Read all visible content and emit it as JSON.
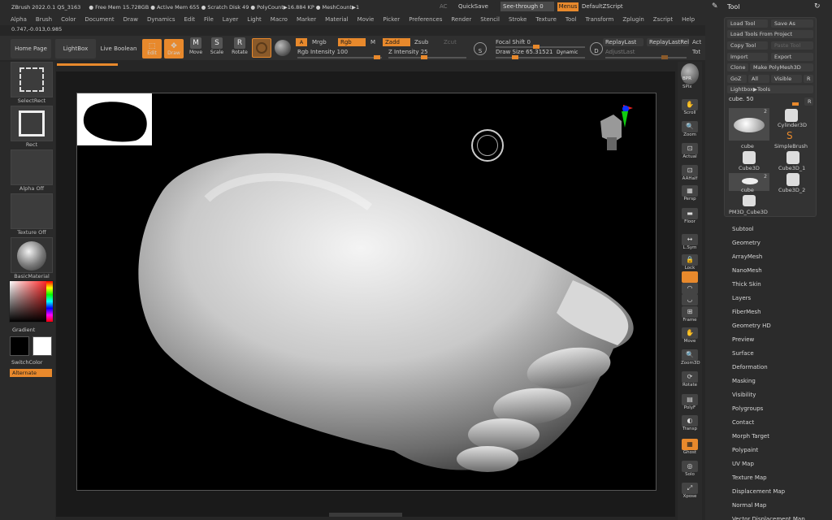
{
  "titlebar": {
    "app": "ZBrush 2022.0.1 QS_3163",
    "status": "● Free Mem 15.728GB ● Active Mem 655 ● Scratch Disk 49 ● PolyCount▶16.884 KP ● MeshCount▶1",
    "ac": "AC",
    "quicksave": "QuickSave",
    "seethrough": "See-through 0",
    "menus": "Menus",
    "script": "DefaultZScript"
  },
  "menubar": [
    "Alpha",
    "Brush",
    "Color",
    "Document",
    "Draw",
    "Dynamics",
    "Edit",
    "File",
    "Layer",
    "Light",
    "Macro",
    "Marker",
    "Material",
    "Movie",
    "Picker",
    "Preferences",
    "Render",
    "Stencil",
    "Stroke",
    "Texture",
    "Tool",
    "Transform",
    "Zplugin",
    "Zscript",
    "Help"
  ],
  "coords": "0.747,-0.013,0.985",
  "toolbar": {
    "home": "Home Page",
    "lightbox": "LightBox",
    "liveboolean": "Live Boolean",
    "edit": "Edit",
    "draw": "Draw",
    "move": "Move",
    "scale": "Scale",
    "rotate": "Rotate",
    "a": "A",
    "mrgb": "Mrgb",
    "rgb": "Rgb",
    "m": "M",
    "zadd": "Zadd",
    "zsub": "Zsub",
    "zcut": "Zcut",
    "rgb_intensity": "Rgb Intensity 100",
    "z_intensity": "Z Intensity 25",
    "focal_shift": "Focal Shift 0",
    "draw_size": "Draw Size 65.31521",
    "dynamic": "Dynamic",
    "replaylast": "ReplayLast",
    "replaylastrel": "ReplayLastRel",
    "act": "Act",
    "adjustlast": "AdjustLast",
    "tot": "Tot",
    "s": "S",
    "d": "D"
  },
  "left": {
    "selectrect": "SelectRect",
    "rect": "Rect",
    "alpha": "Alpha Off",
    "texture": "Texture Off",
    "material": "BasicMaterial",
    "gradient": "Gradient",
    "switchcolor": "SwitchColor",
    "alternate": "Alternate"
  },
  "rightstrip": [
    "BPR",
    "SPix",
    "Scroll",
    "Zoom",
    "Actual",
    "AAHalf",
    "Persp",
    "Floor",
    "L.Sym",
    "Lock",
    "XYZ",
    "",
    "",
    "Frame",
    "Move",
    "Zoom3D",
    "Rotate",
    "PolyF",
    "Transp",
    "Ghost",
    "Solo",
    "Xpose"
  ],
  "tool": {
    "title": "Tool",
    "load": "Load Tool",
    "saveas": "Save As",
    "loadproject": "Load Tools From Project",
    "copy": "Copy Tool",
    "paste": "Paste Tool",
    "import": "Import",
    "export": "Export",
    "clone": "Clone",
    "makepoly": "Make PolyMesh3D",
    "goz": "GoZ",
    "all": "All",
    "visible": "Visible",
    "r": "R",
    "lightboxtools": "Lightbox▶Tools",
    "current": "cube. 50",
    "thumbs": [
      {
        "label": "cube",
        "count": "2"
      },
      {
        "label": "Cylinder3D",
        "count": ""
      },
      {
        "label": "SimpleBrush",
        "count": ""
      },
      {
        "label": "Cube3D",
        "count": ""
      },
      {
        "label": "Cube3D_1",
        "count": ""
      },
      {
        "label": "cube",
        "count": "2"
      },
      {
        "label": "Cube3D_2",
        "count": ""
      },
      {
        "label": "PM3D_Cube3D",
        "count": ""
      }
    ]
  },
  "subpalettes": [
    "Subtool",
    "Geometry",
    "ArrayMesh",
    "NanoMesh",
    "Thick Skin",
    "Layers",
    "FiberMesh",
    "Geometry HD",
    "Preview",
    "Surface",
    "Deformation",
    "Masking",
    "Visibility",
    "Polygroups",
    "Contact",
    "Morph Target",
    "Polypaint",
    "UV Map",
    "Texture Map",
    "Displacement Map",
    "Normal Map",
    "Vector Displacement Map"
  ],
  "colors": {
    "accent": "#e8892c",
    "bg": "#262626"
  }
}
